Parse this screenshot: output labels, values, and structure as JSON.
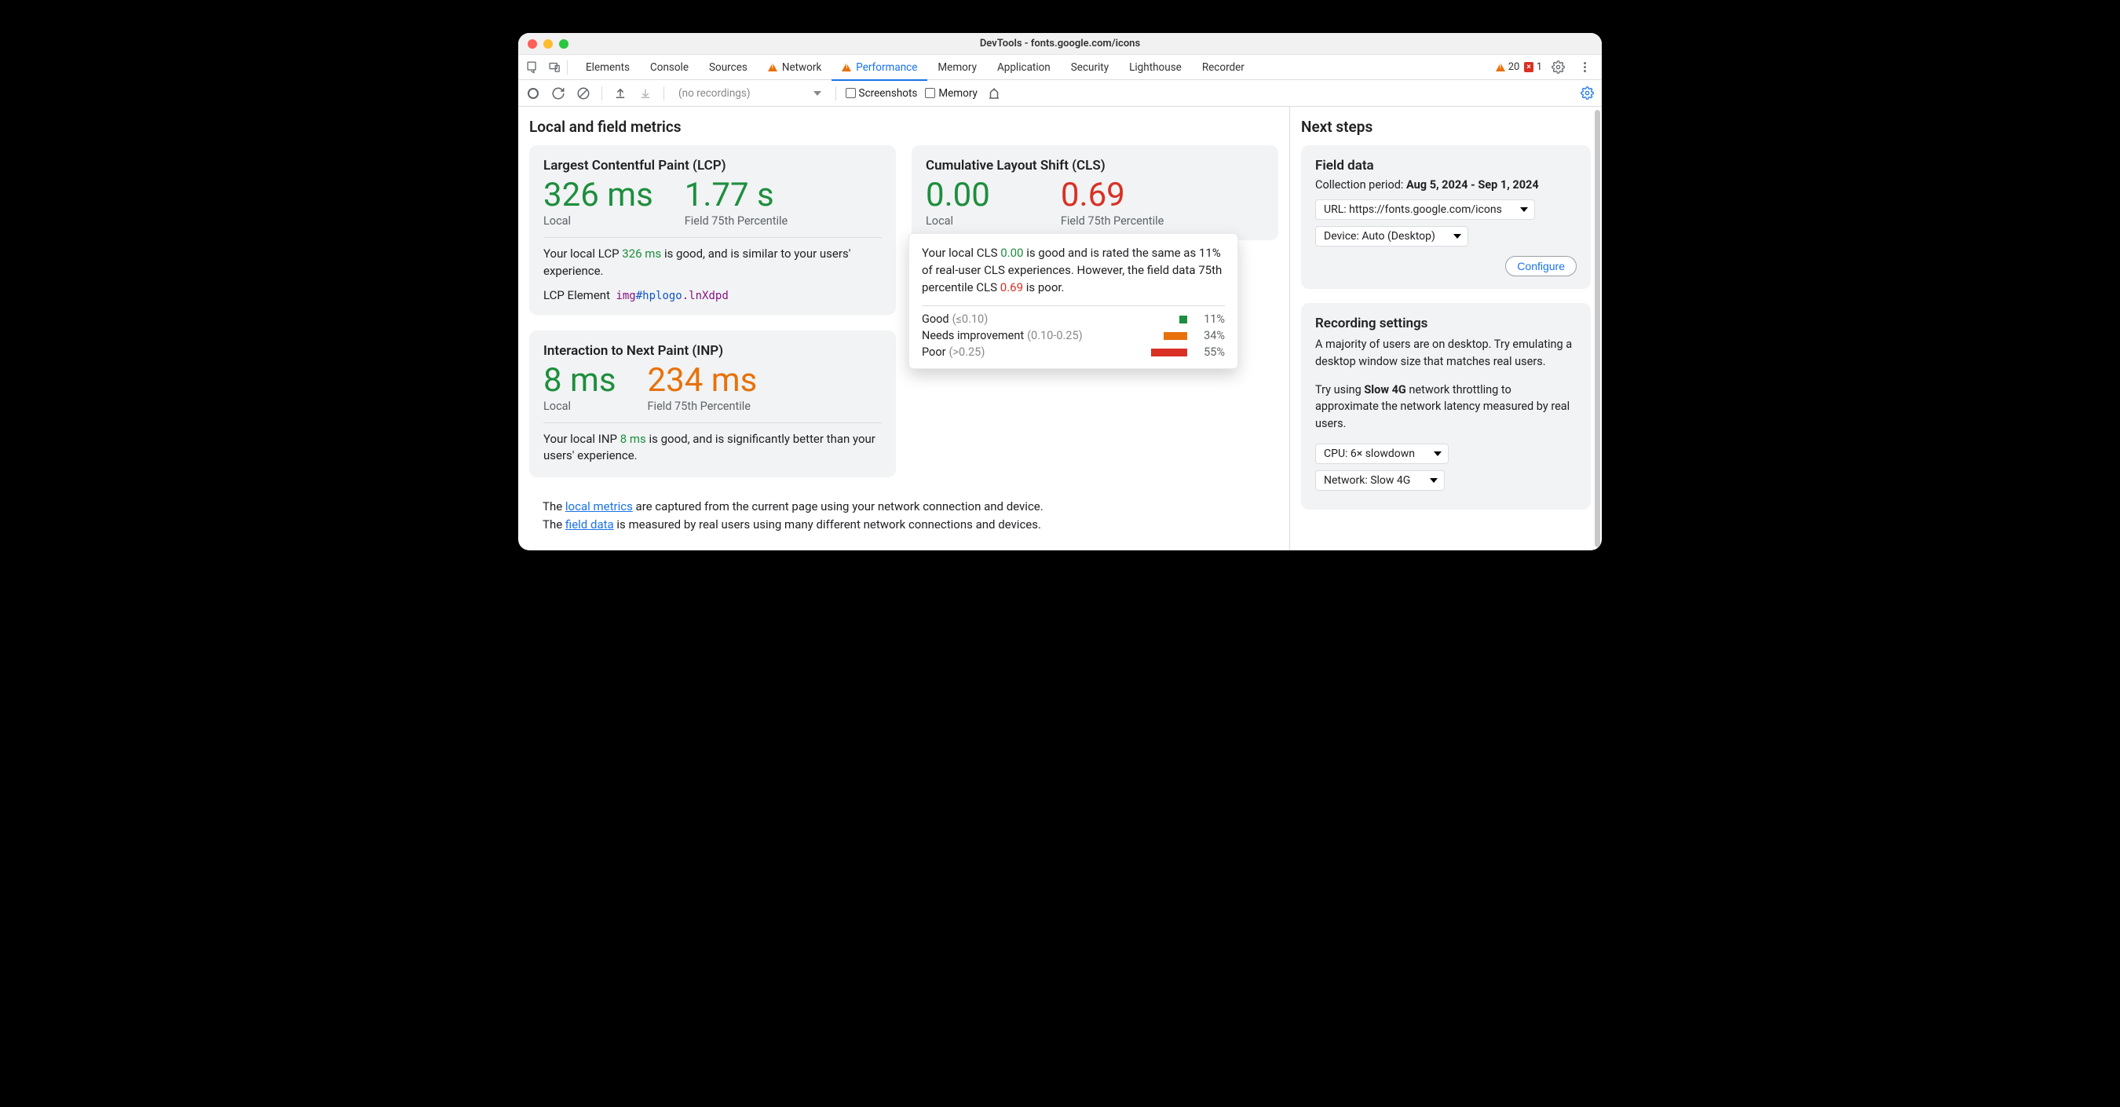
{
  "window": {
    "title": "DevTools - fonts.google.com/icons"
  },
  "tabs": {
    "items": [
      "Elements",
      "Console",
      "Sources",
      "Network",
      "Performance",
      "Memory",
      "Application",
      "Security",
      "Lighthouse",
      "Recorder"
    ],
    "warnTabs": [
      "Network",
      "Performance"
    ],
    "active": "Performance",
    "warnCount": "20",
    "errCount": "1",
    "errBadge": "×"
  },
  "toolbar": {
    "recordings_placeholder": "(no recordings)",
    "screenshots_label": "Screenshots",
    "memory_label": "Memory"
  },
  "main": {
    "heading": "Local and field metrics",
    "lcp": {
      "title": "Largest Contentful Paint (LCP)",
      "local": "326 ms",
      "field": "1.77 s",
      "localLabel": "Local",
      "fieldLabel": "Field 75th Percentile",
      "text_pre": "Your local LCP ",
      "text_lcp": "326 ms",
      "text_post": " is good, and is similar to your users' experience.",
      "elLabel": "LCP Element",
      "el_tag": "img",
      "el_id": "#hplogo",
      "el_cls": ".lnXdpd"
    },
    "inp": {
      "title": "Interaction to Next Paint (INP)",
      "local": "8 ms",
      "field": "234 ms",
      "localLabel": "Local",
      "fieldLabel": "Field 75th Percentile",
      "text_pre": "Your local INP ",
      "text_val": "8 ms",
      "text_post": " is good, and is significantly better than your users' experience."
    },
    "cls": {
      "title": "Cumulative Layout Shift (CLS)",
      "local": "0.00",
      "field": "0.69",
      "localLabel": "Local",
      "fieldLabel": "Field 75th Percentile",
      "tooltip": {
        "pre": "Your local CLS ",
        "good": "0.00",
        "mid": " is good and is rated the same as 11% of real-user CLS experiences. However, the field data 75th percentile CLS ",
        "bad": "0.69",
        "post": " is poor.",
        "rows": [
          {
            "label": "Good",
            "range": "(≤0.10)",
            "pct": "11%",
            "color": "#1e8e3e",
            "w": 10
          },
          {
            "label": "Needs improvement",
            "range": "(0.10-0.25)",
            "pct": "34%",
            "color": "#e8710a",
            "w": 30
          },
          {
            "label": "Poor",
            "range": "(>0.25)",
            "pct": "55%",
            "color": "#d93025",
            "w": 46
          }
        ]
      }
    },
    "info": {
      "l1a": "The ",
      "l1link": "local metrics",
      "l1b": " are captured from the current page using your network connection and device.",
      "l2a": "The ",
      "l2link": "field data",
      "l2b": " is measured by real users using many different network connections and devices."
    }
  },
  "side": {
    "heading": "Next steps",
    "fielddata": {
      "title": "Field data",
      "period_label": "Collection period: ",
      "period": "Aug 5, 2024 - Sep 1, 2024",
      "url": "URL: https://fonts.google.com/icons",
      "device": "Device: Auto (Desktop)",
      "configure": "Configure"
    },
    "recording": {
      "title": "Recording settings",
      "text1": "A majority of users are on desktop. Try emulating a desktop window size that matches real users.",
      "text2a": "Try using ",
      "text2b": "Slow 4G",
      "text2c": " network throttling to approximate the network latency measured by real users.",
      "cpu": "CPU: 6× slowdown",
      "network": "Network: Slow 4G"
    }
  }
}
